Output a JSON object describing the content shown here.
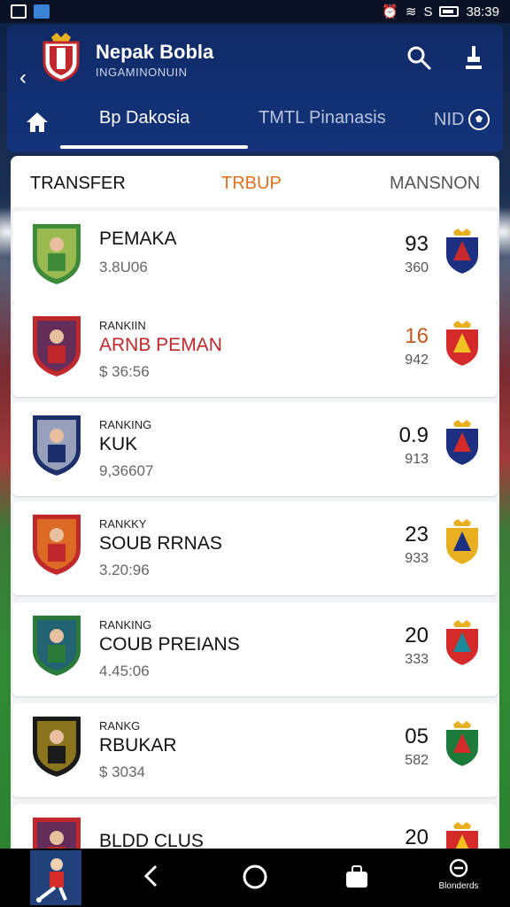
{
  "status_bar": {
    "time": "38:39"
  },
  "header": {
    "title": "Nepak Bobla",
    "subtitle": "INGAMINONUIN",
    "tabs": [
      {
        "label": "Bp Dakosia",
        "active": true
      },
      {
        "label": "TMTL Pinanasis",
        "active": false
      },
      {
        "label": "NID",
        "active": false
      }
    ]
  },
  "table": {
    "columns": [
      "TRANSFER",
      "TRBUP",
      "MANSNON"
    ],
    "rows": [
      {
        "rank_label": "",
        "name": "PEMAKA",
        "value": "3.8U06",
        "score": "93",
        "sub": "360",
        "name_color": "#111111",
        "score_color": "#111111",
        "badge_colors": [
          "#3c8a3a",
          "#e8e060"
        ],
        "club_colors": [
          "#1c2f80",
          "#c8282c"
        ]
      },
      {
        "rank_label": "RANKIIN",
        "name": "ARNB PEMAN",
        "value": "$ 36:56",
        "score": "16",
        "sub": "942",
        "name_color": "#c0282c",
        "score_color": "#c25a1f",
        "badge_colors": [
          "#c0282c",
          "#1c2f80"
        ],
        "club_colors": [
          "#d42a2a",
          "#f2c020"
        ]
      },
      {
        "rank_label": "RANKING",
        "name": "KUK",
        "value": "9,36607",
        "score": "0.9",
        "sub": "913",
        "name_color": "#111111",
        "score_color": "#111111",
        "badge_colors": [
          "#1c2f6a",
          "#ffffff"
        ],
        "club_colors": [
          "#1c2f80",
          "#d42a2a"
        ]
      },
      {
        "rank_label": "RANKKY",
        "name": "SOUB RRNAS",
        "value": "3.20:96",
        "score": "23",
        "sub": "933",
        "name_color": "#111111",
        "score_color": "#111111",
        "badge_colors": [
          "#c0282c",
          "#f2a020"
        ],
        "club_colors": [
          "#e8b020",
          "#1c2f80"
        ]
      },
      {
        "rank_label": "RANKING",
        "name": "COUB PREIANS",
        "value": "4.45:06",
        "score": "20",
        "sub": "333",
        "name_color": "#111111",
        "score_color": "#111111",
        "badge_colors": [
          "#2a7a3a",
          "#1c4fa0"
        ],
        "club_colors": [
          "#d42a2a",
          "#1c8a9a"
        ]
      },
      {
        "rank_label": "RANKG",
        "name": "RBUKAR",
        "value": "$ 3034",
        "score": "05",
        "sub": "582",
        "name_color": "#111111",
        "score_color": "#111111",
        "badge_colors": [
          "#1a1a1a",
          "#e8c020"
        ],
        "club_colors": [
          "#1c7a3a",
          "#d42a2a"
        ]
      },
      {
        "rank_label": "",
        "name": "BLDD CLUS",
        "value": "",
        "score": "20",
        "sub": "",
        "name_color": "#111111",
        "score_color": "#111111",
        "badge_colors": [
          "#c0282c",
          "#1c2f80"
        ],
        "club_colors": [
          "#d42a2a",
          "#f2c020"
        ]
      }
    ]
  },
  "navbar": {
    "misc_label": "Blonderds"
  },
  "colors": {
    "header_bg": "#14337a",
    "accent_orange": "#e07020",
    "accent_red": "#c0282c"
  }
}
